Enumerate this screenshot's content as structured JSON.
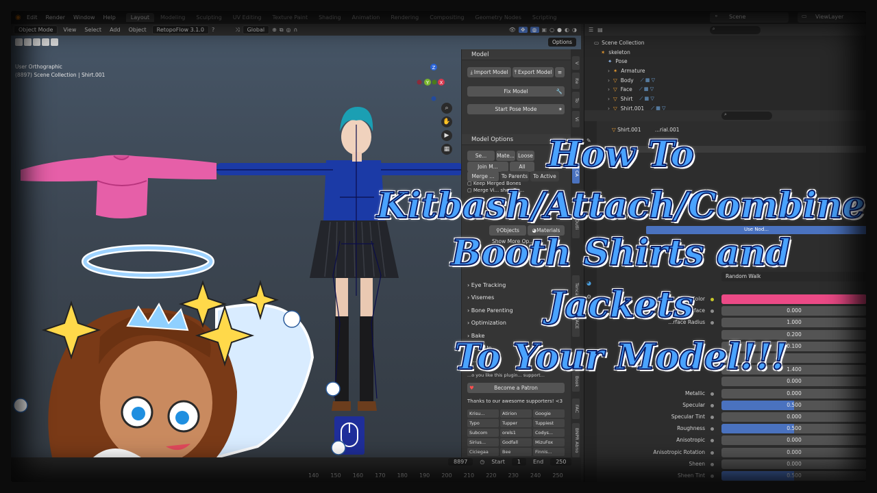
{
  "menubar": {
    "menus": [
      "Edit",
      "Render",
      "Window",
      "Help"
    ],
    "workspaces": [
      "Layout",
      "Modeling",
      "Sculpting",
      "UV Editing",
      "Texture Paint",
      "Shading",
      "Animation",
      "Rendering",
      "Compositing",
      "Geometry Nodes",
      "Scripting"
    ],
    "scene": "Scene",
    "view_layer": "ViewLayer"
  },
  "viewport_header": {
    "mode": "Object Mode",
    "menus": [
      "View",
      "Select",
      "Add",
      "Object"
    ],
    "addon": "RetopoFlow 3.1.0",
    "orientation": "Global",
    "options": "Options"
  },
  "viewport": {
    "view_name": "User Orthographic",
    "collection_info": "(8897) Scene Collection | Shirt.001",
    "gizmo_axes": [
      "Z",
      "Y",
      "X"
    ]
  },
  "npanel": {
    "model_header": "Model",
    "import_model": "Import Model",
    "export_model": "Export Model",
    "fix_model": "Fix Model",
    "start_pose_mode": "Start Pose Mode",
    "model_options_header": "Model Options",
    "se": "Se...",
    "mate": "Mate...",
    "loose": "Loose",
    "join_m": "Join M...",
    "all": "All",
    "merge": "Merge ...",
    "to_parents": "To Parents",
    "to_active": "To Active",
    "keep_merged": "Keep Merged Bones",
    "merge_vi": "Merge Vi... shes Ga...",
    "objects": "Objects",
    "materials": "Materials",
    "show_more": "Show More Op...",
    "sections": [
      "Eye Tracking",
      "Visemes",
      "Bone Parenting",
      "Optimization",
      "Bake",
      "... & Up...",
      "... s"
    ],
    "supporter_text": "...o you like this plugin... support...",
    "patron_button": "Become a Patron",
    "thanks": "Thanks to our awesome supporters! <3",
    "supporters": [
      [
        "Krisu...",
        "Atirion",
        "Googie"
      ],
      [
        "Typo",
        "Tupper",
        "Tuppiest"
      ],
      [
        "Subcom",
        "orels1",
        "Codys..."
      ],
      [
        "Sirius...",
        "Godfall",
        "MizuFox"
      ],
      [
        "Ciciegaa",
        "Bee",
        "Finnis..."
      ]
    ],
    "tabs": [
      "V",
      "Ite",
      "To",
      "Vi",
      "CA",
      "Outli",
      "Tenca",
      "FACE",
      "Book",
      "FAC",
      "BNPR Abno"
    ]
  },
  "timeline": {
    "current_frame": "8897",
    "start_label": "Start",
    "start_value": "1",
    "end_label": "End",
    "end_value": "250",
    "ticks": [
      "140",
      "150",
      "160",
      "170",
      "180",
      "190",
      "200",
      "210",
      "220",
      "230",
      "240",
      "250"
    ]
  },
  "outliner": {
    "root": "Scene Collection",
    "items": [
      {
        "name": "skeleton",
        "level": 0,
        "icon": "armature-object-icon"
      },
      {
        "name": "Pose",
        "level": 1,
        "icon": "pose-icon"
      },
      {
        "name": "Armature",
        "level": 1,
        "icon": "armature-data-icon"
      },
      {
        "name": "Body",
        "level": 1,
        "icon": "mesh-icon"
      },
      {
        "name": "Face",
        "level": 1,
        "icon": "mesh-icon"
      },
      {
        "name": "Shirt",
        "level": 1,
        "icon": "mesh-icon"
      },
      {
        "name": "Shirt.001",
        "level": 1,
        "icon": "mesh-icon"
      }
    ]
  },
  "properties": {
    "object_name": "Shirt.001",
    "material_slot": "...rial.001",
    "surface_label": "Surface",
    "use_nodes": "Use Nod...",
    "subsurface_method": "Random Walk",
    "rows": [
      {
        "label": "Base Color",
        "value": "",
        "color": "#ec4a86"
      },
      {
        "label": "Subsurface",
        "value": "0.000",
        "fill": 0
      },
      {
        "label": "...rface Radius",
        "value": "1.000",
        "fill": 0
      },
      {
        "label": "",
        "value": "0.200",
        "fill": 0
      },
      {
        "label": "",
        "value": "0.100",
        "fill": 0
      },
      {
        "label": "",
        "value": "",
        "fill": 0
      },
      {
        "label": "",
        "value": "1.400",
        "fill": 0
      },
      {
        "label": "",
        "value": "0.000",
        "fill": 0
      },
      {
        "label": "Metallic",
        "value": "0.000",
        "fill": 0
      },
      {
        "label": "Specular",
        "value": "0.500",
        "fill": 0.5
      },
      {
        "label": "Specular Tint",
        "value": "0.000",
        "fill": 0
      },
      {
        "label": "Roughness",
        "value": "0.500",
        "fill": 0.5
      },
      {
        "label": "Anisotropic",
        "value": "0.000",
        "fill": 0
      },
      {
        "label": "Anisotropic Rotation",
        "value": "0.000",
        "fill": 0
      },
      {
        "label": "Sheen",
        "value": "0.000",
        "fill": 0
      },
      {
        "label": "Sheen Tint",
        "value": "0.500",
        "fill": 0.5
      },
      {
        "label": "Clearcoat",
        "value": "0.000",
        "fill": 0
      }
    ]
  },
  "overlay_title": {
    "line1": "How To",
    "line2": "Kitbash/Attach/Combine",
    "line3": "Booth Shirts and",
    "line4": "Jackets",
    "line5": "To Your Model!!!"
  },
  "colors": {
    "accent": "#4a72bf",
    "title_fill": "#4aa3ff",
    "title_outline": "#0b1e66",
    "shirt_blue": "#1b3aa6",
    "pink_shirt": "#e65fa8",
    "base_color": "#ec4a86"
  }
}
